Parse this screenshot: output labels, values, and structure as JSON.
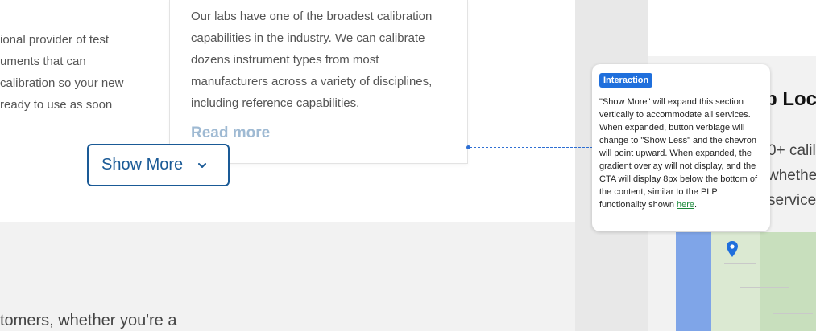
{
  "left_column": {
    "lines": [
      "ional provider of test",
      "uments that can",
      "calibration so your new",
      " ready to use as soon"
    ]
  },
  "card": {
    "body": "Our labs have one of the broadest calibration capabilities in the industry. We can calibrate dozens instrument types from most manufacturers across a variety of disciplines, including reference capabilities.",
    "read_more": "Read more"
  },
  "show_more_button": {
    "label": "Show More",
    "icon": "chevron-down-icon"
  },
  "bottom_text": "tomers, whether you're a",
  "right_panel": {
    "heading": "b Loc",
    "lines": [
      "0+ calil",
      "whethe",
      "service"
    ],
    "map_pin_icon": "map-pin-icon"
  },
  "annotation": {
    "badge": "Interaction",
    "text_before_link": "\"Show More\" will expand this section vertically to accommodate all services. When expanded, button verbiage will change to \"Show Less\" and the chevron will point upward. When expanded, the gradient overlay will not display, and the CTA will display 8px below the bottom of the content, similar to the PLP functionality shown ",
    "link_text": "here",
    "text_after_link": "."
  },
  "colors": {
    "brand_blue": "#1a5a96",
    "annotation_blue": "#1f6fdc",
    "link_green": "#1a8a3a",
    "read_more_faded": "#9fbad3"
  }
}
